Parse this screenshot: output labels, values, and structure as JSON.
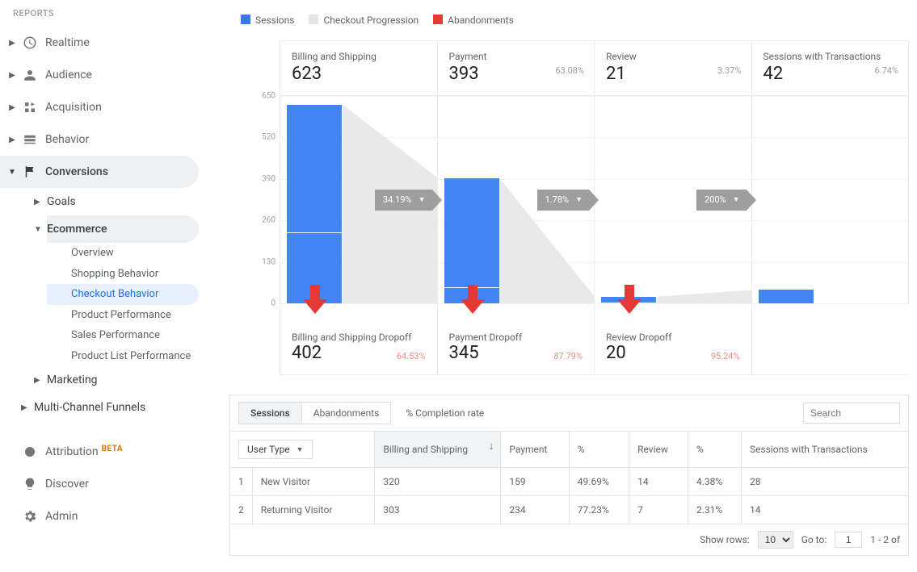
{
  "sidebar": {
    "header": "REPORTS",
    "items": [
      {
        "label": "Realtime",
        "icon": "clock"
      },
      {
        "label": "Audience",
        "icon": "person"
      },
      {
        "label": "Acquisition",
        "icon": "acquisition"
      },
      {
        "label": "Behavior",
        "icon": "behavior"
      },
      {
        "label": "Conversions",
        "icon": "flag",
        "active": true
      }
    ],
    "conversions": {
      "goals": "Goals",
      "ecommerce": "Ecommerce",
      "ecommerce_items": [
        "Overview",
        "Shopping Behavior",
        "Checkout Behavior",
        "Product Performance",
        "Sales Performance",
        "Product List Performance"
      ],
      "current_index": 2,
      "marketing": "Marketing",
      "multichannel": "Multi-Channel Funnels"
    },
    "bottom": {
      "attribution": "Attribution",
      "attribution_badge": "BETA",
      "discover": "Discover",
      "admin": "Admin"
    }
  },
  "legend": {
    "sessions": "Sessions",
    "checkout": "Checkout Progression",
    "aband": "Abandonments"
  },
  "chart_data": {
    "type": "bar",
    "y_ticks": [
      0,
      130,
      260,
      390,
      520,
      650
    ],
    "ymax": 650,
    "stages": [
      {
        "title": "Billing and Shipping",
        "value": 623,
        "progression": 221,
        "pct": null,
        "drop_title": "Billing and Shipping Dropoff",
        "drop_val": 402,
        "drop_pct": "64.53%",
        "tag": "34.19%"
      },
      {
        "title": "Payment",
        "value": 393,
        "progression": 48,
        "pct": "63.08%",
        "drop_title": "Payment Dropoff",
        "drop_val": 345,
        "drop_pct": "87.79%",
        "tag": "1.78%"
      },
      {
        "title": "Review",
        "value": 21,
        "progression": 1,
        "pct": "3.37%",
        "drop_title": "Review Dropoff",
        "drop_val": 20,
        "drop_pct": "95.24%",
        "tag": "200%"
      },
      {
        "title": "Sessions with Transactions",
        "value": 42,
        "progression": null,
        "pct": "6.74%"
      }
    ]
  },
  "table": {
    "tabs": {
      "sessions": "Sessions",
      "aband": "Abandonments"
    },
    "completion_label": "% Completion rate",
    "search_placeholder": "Search",
    "dimension_label": "User Type",
    "columns": {
      "billing": "Billing and Shipping",
      "payment": "Payment",
      "pct1": "%",
      "review": "Review",
      "pct2": "%",
      "swt": "Sessions with Transactions"
    },
    "rows": [
      {
        "idx": "1",
        "name": "New Visitor",
        "billing": "320",
        "payment": "159",
        "pct1": "49.69%",
        "review": "14",
        "pct2": "4.38%",
        "swt": "28"
      },
      {
        "idx": "2",
        "name": "Returning Visitor",
        "billing": "303",
        "payment": "234",
        "pct1": "77.23%",
        "review": "7",
        "pct2": "2.31%",
        "swt": "14"
      }
    ],
    "pager": {
      "show_rows": "Show rows:",
      "rows_value": "10",
      "goto": "Go to:",
      "goto_value": "1",
      "range": "1 - 2 of"
    }
  }
}
